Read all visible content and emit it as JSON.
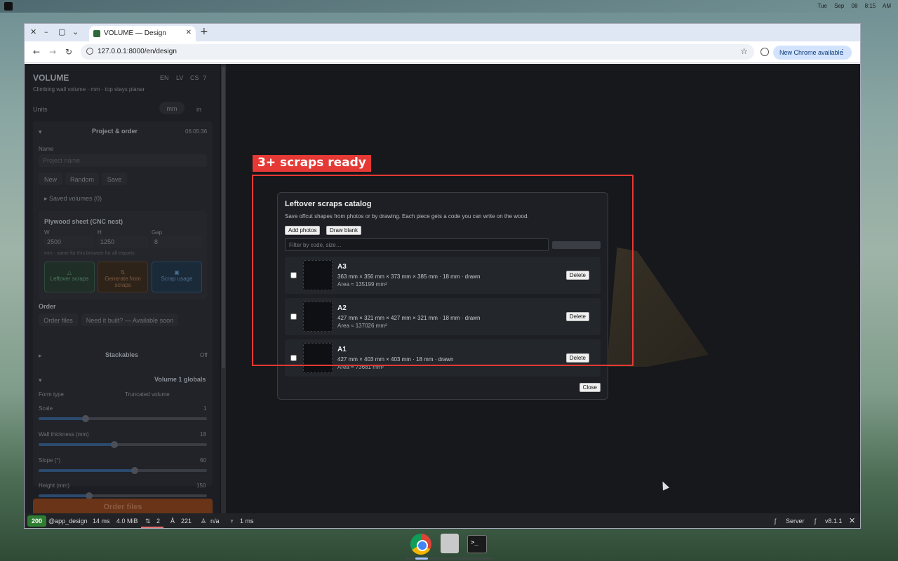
{
  "os": {
    "clock": "Tue Sep 08   8:15 AM"
  },
  "browser": {
    "tab_title": "VOLUME — Design",
    "url": "127.0.0.1:8000/en/design",
    "update_label": "New Chrome available"
  },
  "sidebar": {
    "app_title": "VOLUME",
    "languages": [
      "EN",
      "LV",
      "CS",
      "?"
    ],
    "subtitle": "Climbing wall volume · mm · top stays planar",
    "units_label": "Units",
    "unit_options": [
      "mm",
      "in"
    ],
    "project_section": "Project & order",
    "project_time": "06:05:36",
    "name_label": "Name",
    "name_placeholder": "Project name",
    "project_buttons": [
      "New",
      "Random",
      "Save"
    ],
    "saved_volumes": "▸ Saved volumes (0)",
    "plywood_title": "Plywood sheet (CNC nest)",
    "sheet_labels": [
      "W",
      "H",
      "Gap"
    ],
    "sheet_values": [
      "2500",
      "1250",
      "8"
    ],
    "sheet_hint": "mm · same for this browser for all exports",
    "tiles": [
      {
        "icon": "△",
        "label": "Leftover scraps"
      },
      {
        "icon": "⇅",
        "label": "Generate from scraps"
      },
      {
        "icon": "▣",
        "label": "Scrap usage"
      }
    ],
    "order_title": "Order",
    "order_buttons": [
      "Order files",
      "Need it built? — Available soon"
    ],
    "stackables_title": "Stackables",
    "stackables_value": "Off",
    "volume_title": "Volume 1 globals",
    "form_type_label": "Form type",
    "form_type_value": "Truncated volume",
    "sliders": [
      {
        "label": "Scale",
        "value": "1",
        "fraction": 0.28
      },
      {
        "label": "Wall thickness (mm)",
        "value": "18",
        "fraction": 0.45
      },
      {
        "label": "Slope (°)",
        "value": "60",
        "fraction": 0.57
      },
      {
        "label": "Height (mm)",
        "value": "150",
        "fraction": 0.3
      }
    ],
    "order_files_cta": "Order files"
  },
  "overlay": {
    "label": "3+ scraps ready"
  },
  "modal": {
    "title": "Leftover scraps catalog",
    "description": "Save offcut shapes from photos or by drawing. Each piece gets a code you can write on the wood.",
    "add_photos": "Add photos",
    "draw_blank": "Draw blank",
    "filter_placeholder": "Filter by code, size…",
    "close_label": "Close",
    "delete_label": "Delete",
    "scraps": [
      {
        "code": "A3",
        "dims": "363 mm × 356 mm × 373 mm × 385 mm · 18 mm · drawn",
        "area": "Area ≈ 135199 mm²"
      },
      {
        "code": "A2",
        "dims": "427 mm × 321 mm × 427 mm × 321 mm · 18 mm · drawn",
        "area": "Area ≈ 137026 mm²"
      },
      {
        "code": "A1",
        "dims": "427 mm × 403 mm × 403 mm · 18 mm · drawn",
        "area": "Area ≈ 73681 mm²"
      }
    ]
  },
  "debug_bar": {
    "status": "200",
    "route": "@app_design",
    "time": "14 ms",
    "memory": "4.0 MiB",
    "requests": "2",
    "translations": "221",
    "user": "n/a",
    "twig": "1 ms",
    "server_label": "Server",
    "version": "v8.1.1"
  }
}
